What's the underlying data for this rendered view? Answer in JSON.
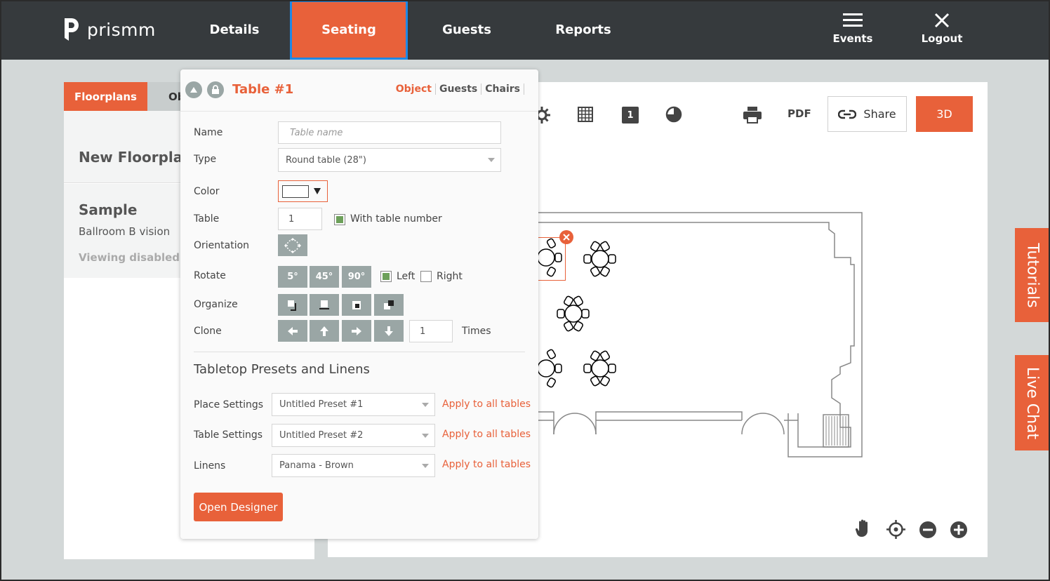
{
  "brand": {
    "name": "prismm"
  },
  "nav": {
    "tabs": [
      "Details",
      "Seating",
      "Guests",
      "Reports"
    ],
    "active_tab": "Seating",
    "events_label": "Events",
    "logout_label": "Logout"
  },
  "sidebar": {
    "tabs": [
      "Floorplans",
      "Ob"
    ],
    "floorplans": [
      {
        "title": "New Floorplan"
      },
      {
        "title": "Sample",
        "subtitle": "Ballroom B vision",
        "note": "Viewing disabled in"
      }
    ]
  },
  "toolbar": {
    "table_number_label": "1",
    "pdf_label": "PDF",
    "share_label": "Share",
    "three_d_label": "3D"
  },
  "side_tabs": {
    "tutorials": "Tutorials",
    "live_chat": "Live Chat"
  },
  "popup": {
    "title": "Table #1",
    "tabs": [
      "Object",
      "Guests",
      "Chairs"
    ],
    "active_tab": "Object",
    "fields": {
      "name_label": "Name",
      "name_placeholder": "Table name",
      "type_label": "Type",
      "type_value": "Round table (28\")",
      "color_label": "Color",
      "table_label": "Table",
      "table_value": "1",
      "with_table_number_label": "With table number",
      "orientation_label": "Orientation",
      "rotate_label": "Rotate",
      "rotate_options": [
        "5°",
        "45°",
        "90°"
      ],
      "left_label": "Left",
      "right_label": "Right",
      "organize_label": "Organize",
      "clone_label": "Clone",
      "clone_times_value": "1",
      "times_label": "Times"
    },
    "presets": {
      "section_title": "Tabletop Presets and Linens",
      "place_settings_label": "Place Settings",
      "place_settings_value": "Untitled Preset #1",
      "table_settings_label": "Table Settings",
      "table_settings_value": "Untitled Preset #2",
      "linens_label": "Linens",
      "linens_value": "Panama - Brown",
      "apply_label": "Apply to all tables"
    },
    "open_designer_label": "Open Designer"
  },
  "colors": {
    "accent": "#e8613a",
    "nav_bg": "#363a3d",
    "button_grey": "#9aa6a5",
    "check_green": "#6da05a"
  }
}
